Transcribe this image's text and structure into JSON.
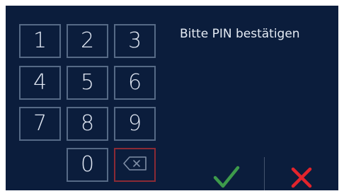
{
  "keypad": {
    "keys": [
      "1",
      "2",
      "3",
      "4",
      "5",
      "6",
      "7",
      "8",
      "9",
      "0"
    ],
    "backspace_icon": "backspace-icon"
  },
  "prompt": {
    "text": "Bitte PIN bestätigen"
  },
  "actions": {
    "confirm_icon": "checkmark-icon",
    "cancel_icon": "cross-icon"
  },
  "colors": {
    "background": "#0b1d3c",
    "key_border": "#566a86",
    "key_text": "#dfe6f2",
    "delete_border": "#8a2a35",
    "confirm": "#3d9a4b",
    "cancel": "#e2242c"
  }
}
